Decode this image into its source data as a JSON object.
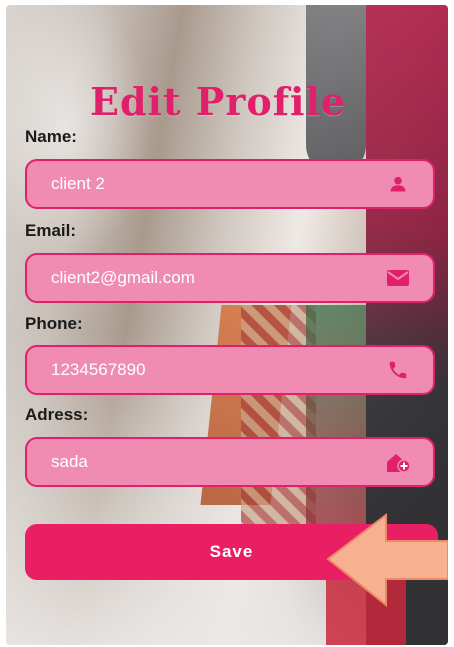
{
  "page": {
    "title": "Edit Profile"
  },
  "form": {
    "name": {
      "label": "Name:",
      "value": "client 2",
      "icon": "person-icon"
    },
    "email": {
      "label": "Email:",
      "value": "client2@gmail.com",
      "icon": "mail-icon"
    },
    "phone": {
      "label": "Phone:",
      "value": "1234567890",
      "icon": "phone-icon"
    },
    "address": {
      "label": "Adress:",
      "value": "sada",
      "icon": "home-add-icon"
    }
  },
  "actions": {
    "save_label": "Save"
  },
  "colors": {
    "accent": "#e0206a",
    "field_fill": "#f08bb2",
    "button": "#e91e63",
    "annotation_arrow": "#f7b191"
  }
}
